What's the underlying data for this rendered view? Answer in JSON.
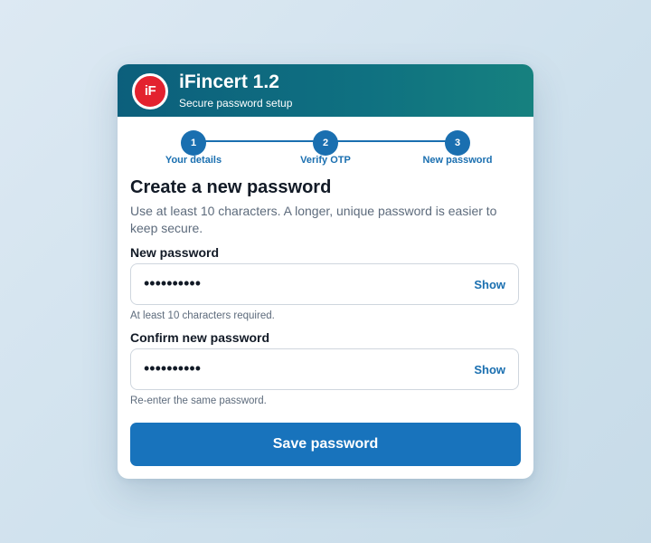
{
  "header": {
    "logo_text": "iF",
    "title": "iFincert 1.2",
    "subtitle": "Secure password setup"
  },
  "stepper": {
    "steps": [
      {
        "number": "1",
        "label": "Your details"
      },
      {
        "number": "2",
        "label": "Verify OTP"
      },
      {
        "number": "3",
        "label": "New password"
      }
    ]
  },
  "form": {
    "heading": "Create a new password",
    "intro": "Use at least 10 characters. A longer, unique password is easier to keep secure.",
    "new_password": {
      "label": "New password",
      "value": "••••••••••",
      "show_label": "Show",
      "hint": "At least 10 characters required."
    },
    "confirm_password": {
      "label": "Confirm new password",
      "value": "••••••••••",
      "show_label": "Show",
      "hint": "Re-enter the same password."
    },
    "submit_label": "Save password"
  },
  "colors": {
    "header_start": "#0c5f7c",
    "header_end": "#16817f",
    "logo": "#e3222f",
    "accent": "#1a6fb0",
    "button": "#1873bc"
  }
}
